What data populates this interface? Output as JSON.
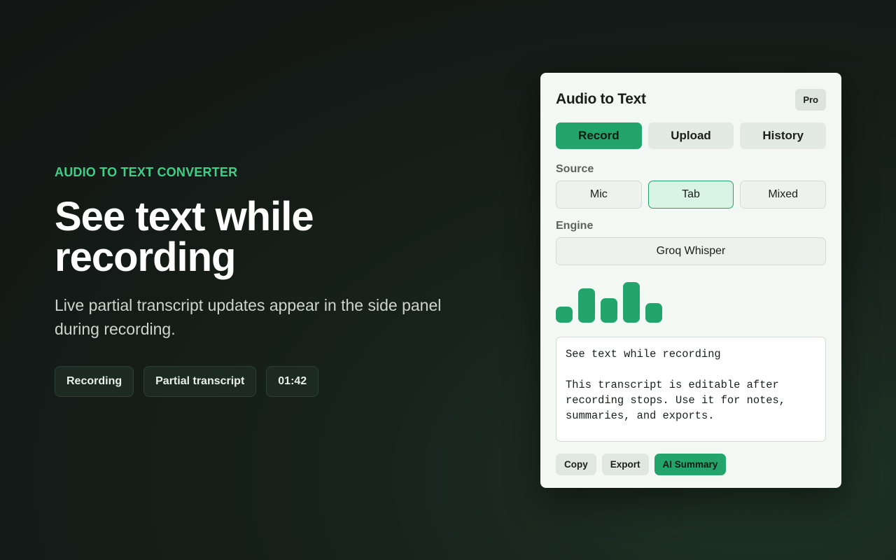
{
  "hero": {
    "eyebrow": "AUDIO TO TEXT CONVERTER",
    "headline": "See text while recording",
    "subtitle": "Live partial transcript updates appear in the side panel during recording.",
    "chips": [
      "Recording",
      "Partial transcript",
      "01:42"
    ]
  },
  "panel": {
    "title": "Audio to Text",
    "badge": "Pro",
    "tabs": [
      {
        "label": "Record",
        "active": true
      },
      {
        "label": "Upload",
        "active": false
      },
      {
        "label": "History",
        "active": false
      }
    ],
    "source_label": "Source",
    "sources": [
      {
        "label": "Mic",
        "active": false
      },
      {
        "label": "Tab",
        "active": true
      },
      {
        "label": "Mixed",
        "active": false
      }
    ],
    "engine_label": "Engine",
    "engine_value": "Groq Whisper",
    "meter_levels": [
      0.4,
      0.84,
      0.6,
      1.0,
      0.48
    ],
    "transcript": "See text while recording\n\nThis transcript is editable after\nrecording stops. Use it for notes,\nsummaries, and exports.",
    "actions": [
      {
        "label": "Copy",
        "primary": false
      },
      {
        "label": "Export",
        "primary": false
      },
      {
        "label": "AI Summary",
        "primary": true
      }
    ]
  },
  "colors": {
    "accent": "#22a46b",
    "eyebrow": "#3fcf87",
    "panel_bg": "#f4f8f4",
    "page_bg": "#141a17"
  }
}
